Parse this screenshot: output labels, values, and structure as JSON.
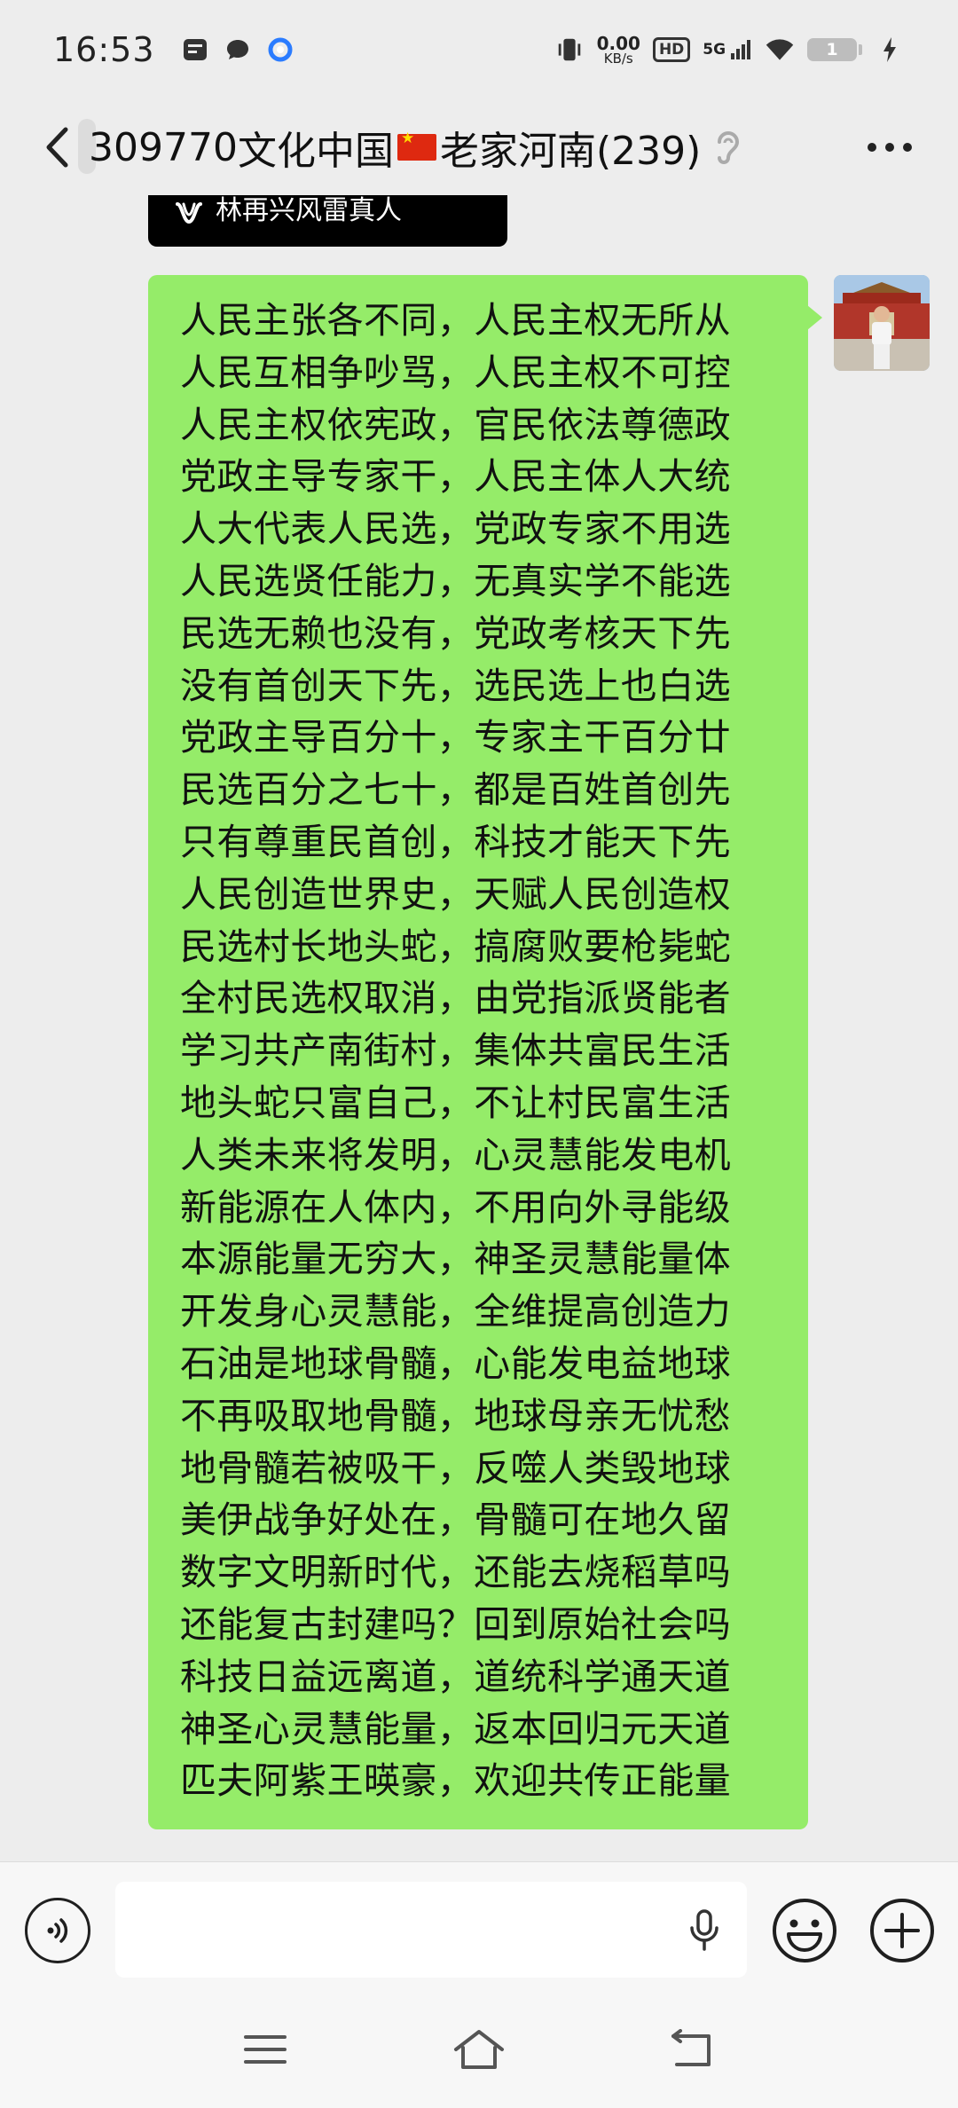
{
  "status_bar": {
    "time": "16:53",
    "net_speed_value": "0.00",
    "net_speed_unit": "KB/s",
    "hd_label": "HD",
    "signal_label": "5G",
    "battery_level": "1"
  },
  "header": {
    "group_id": "309770",
    "title_part1": "文化中国",
    "title_part2": "老家河南(239)"
  },
  "chat": {
    "previous_card_text": "林再兴风雷真人",
    "message_lines": [
      "人民主张各不同，人民主权无所从",
      "人民互相争吵骂，人民主权不可控",
      "人民主权依宪政，官民依法尊德政",
      "党政主导专家干，人民主体人大统",
      "人大代表人民选，党政专家不用选",
      "人民选贤任能力，无真实学不能选",
      "民选无赖也没有，党政考核天下先",
      "没有首创天下先，选民选上也白选",
      "党政主导百分十，专家主干百分廿",
      "民选百分之七十，都是百姓首创先",
      "只有尊重民首创，科技才能天下先",
      "人民创造世界史，天赋人民创造权",
      "民选村长地头蛇，搞腐败要枪毙蛇",
      "全村民选权取消，由党指派贤能者",
      "学习共产南街村，集体共富民生活",
      "地头蛇只富自己，不让村民富生活",
      "人类未来将发明，心灵慧能发电机",
      "新能源在人体内，不用向外寻能级",
      "本源能量无穷大，神圣灵慧能量体",
      "开发身心灵慧能，全维提高创造力",
      "石油是地球骨髓，心能发电益地球",
      "不再吸取地骨髓，地球母亲无忧愁",
      "地骨髓若被吸干，反噬人类毁地球",
      "美伊战争好处在，骨髓可在地久留",
      "数字文明新时代，还能去烧稻草吗",
      "还能复古封建吗？回到原始社会吗",
      "科技日益远离道，道统科学通天道",
      "神圣心灵慧能量，返本回归元天道",
      "匹夫阿紫王暎豪，欢迎共传正能量"
    ]
  },
  "colors": {
    "bubble_green": "#95ec69",
    "background": "#ededed"
  }
}
